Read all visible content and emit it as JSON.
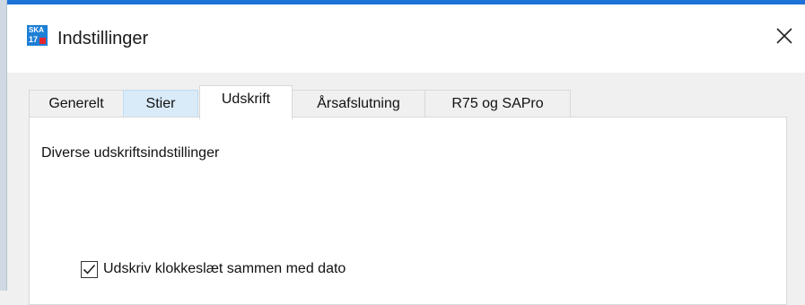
{
  "window": {
    "title": "Indstillinger",
    "app_icon": {
      "name": "ska-app-icon",
      "text_top": "SKA",
      "text_bottom": "17",
      "color": "#1d7fd6",
      "accent": "#e3262f"
    },
    "close_icon": "close-icon"
  },
  "tabs": [
    {
      "label": "Generelt",
      "state": "normal"
    },
    {
      "label": "Stier",
      "state": "hover"
    },
    {
      "label": "Udskrift",
      "state": "active"
    },
    {
      "label": "Årsafslutning",
      "state": "normal"
    },
    {
      "label": "R75 og SAPro",
      "state": "normal"
    }
  ],
  "panel": {
    "heading": "Diverse udskriftsindstillinger",
    "checkbox": {
      "label": "Udskriv klokkeslæt sammen med  dato",
      "checked": true,
      "icon": "checkmark-icon"
    }
  },
  "colors": {
    "title_accent": "#1e73d8",
    "tab_hover": "#d9ebf9",
    "panel_bg": "#ffffff",
    "window_bg": "#f0f0f0"
  }
}
